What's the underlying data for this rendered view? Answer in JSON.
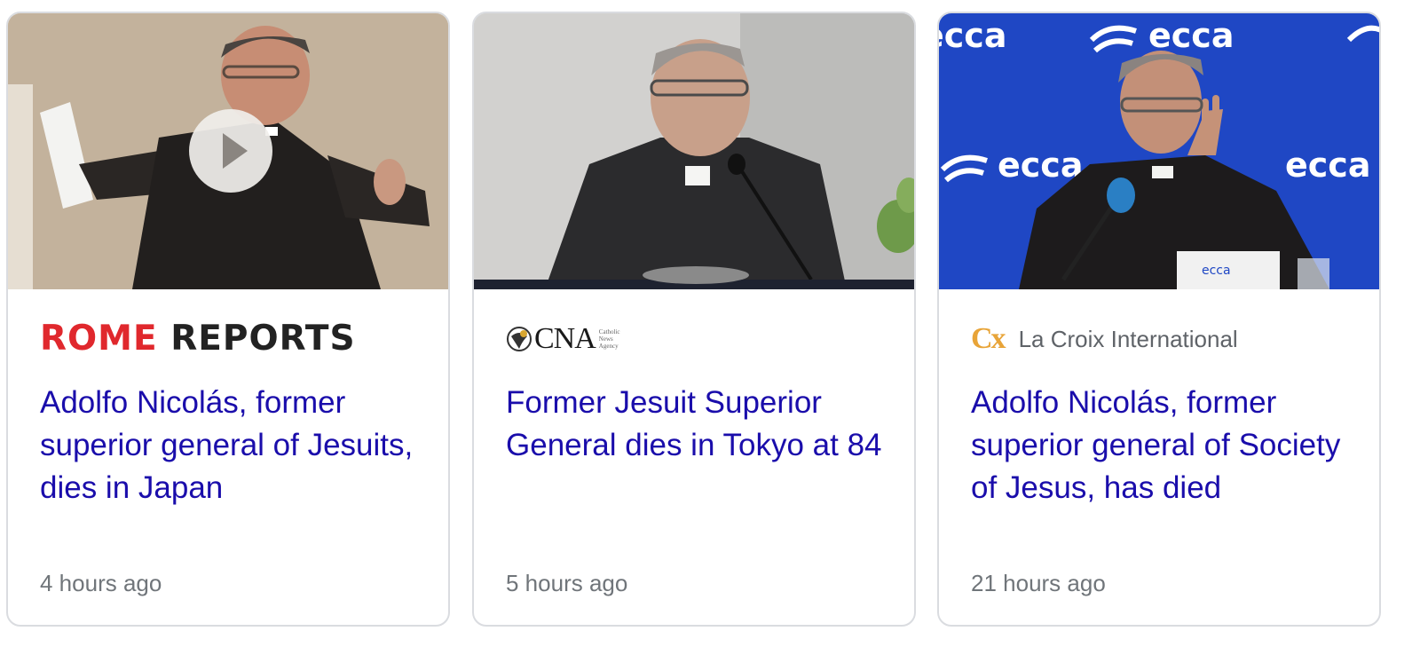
{
  "cards": [
    {
      "source_name": "ROME REPORTS",
      "source_name_red": "ROME",
      "source_name_dark": "REPORTS",
      "headline": "Adolfo Nicolás, former superior general of Jesuits, dies in Japan",
      "time": "4 hours ago",
      "has_video": true
    },
    {
      "source_name": "CNA",
      "source_sub": "Catholic News Agency",
      "headline": "Former Jesuit Superior General dies in Tokyo at 84",
      "time": "5 hours ago",
      "has_video": false
    },
    {
      "source_logo": "Cx",
      "source_name": "La Croix International",
      "headline": "Adolfo Nicolás, former superior general of Society of Jesus, has died",
      "time": "21 hours ago",
      "has_video": false,
      "backdrop_text": "ecca"
    }
  ],
  "colors": {
    "headline": "#1a0dab",
    "meta": "#70757a",
    "border": "#dadce0",
    "rome_red": "#e0282d",
    "croix_gold": "#e8a438",
    "ecca_blue": "#1f47c4"
  },
  "icons": {
    "play": "play-icon",
    "cna": "cna-globe-icon"
  }
}
